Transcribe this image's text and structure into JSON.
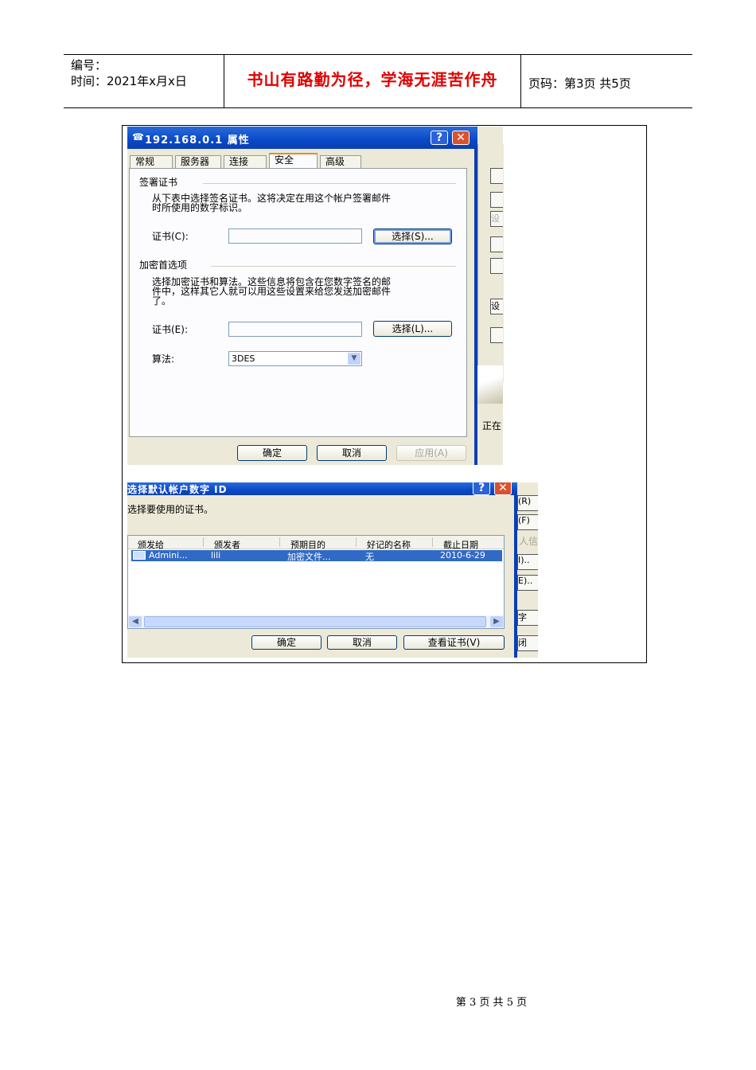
{
  "header": {
    "code_label": "编号：",
    "time_label": "时间：2021年x月x日",
    "motto": "书山有路勤为径，学海无涯苦作舟",
    "page_label": "页码：第3页  共5页",
    "motto_color": "#e00000"
  },
  "dialog1": {
    "title": "192.168.0.1 属性",
    "help_glyph": "?",
    "close_glyph": "✕",
    "tabs": [
      "常规",
      "服务器",
      "连接",
      "安全",
      "高级"
    ],
    "active_tab": "安全",
    "sign_section": "签署证书",
    "sign_desc_line1": "从下表中选择签名证书。这将决定在用这个帐户签署邮件",
    "sign_desc_line2": "时所使用的数字标识。",
    "cert_c_label": "证书(C):",
    "select_s_label": "选择(S)...",
    "enc_section": "加密首选项",
    "enc_desc_line1": "选择加密证书和算法。这些信息将包含在您数字签名的邮",
    "enc_desc_line2": "件中，这样其它人就可以用这些设置来给您发送加密邮件",
    "enc_desc_line3": "了。",
    "cert_e_label": "证书(E):",
    "select_l_label": "选择(L)...",
    "algo_label": "算法:",
    "algo_value": "3DES",
    "ok": "确定",
    "cancel": "取消",
    "apply": "应用(A)",
    "side_fragments": [
      "设",
      "设",
      "正在"
    ]
  },
  "dialog2": {
    "title": "选择默认帐户数字 ID",
    "help_glyph": "?",
    "close_glyph": "✕",
    "prompt": "选择要使用的证书。",
    "columns": [
      "颁发给",
      "颁发者",
      "预期目的",
      "好记的名称",
      "截止日期"
    ],
    "rows": [
      {
        "issued_to": "Admini...",
        "issuer": "lili",
        "purpose": "加密文件...",
        "friendly": "无",
        "expiry": "2010-6-29"
      }
    ],
    "ok": "确定",
    "cancel": "取消",
    "view_cert": "查看证书(V)",
    "side_fragments": [
      "(R)",
      "(F)",
      "人信",
      "I)..",
      "E)..",
      "字(S)",
      "闭"
    ]
  },
  "footer": {
    "page_number": "第 3 页 共 5 页"
  }
}
